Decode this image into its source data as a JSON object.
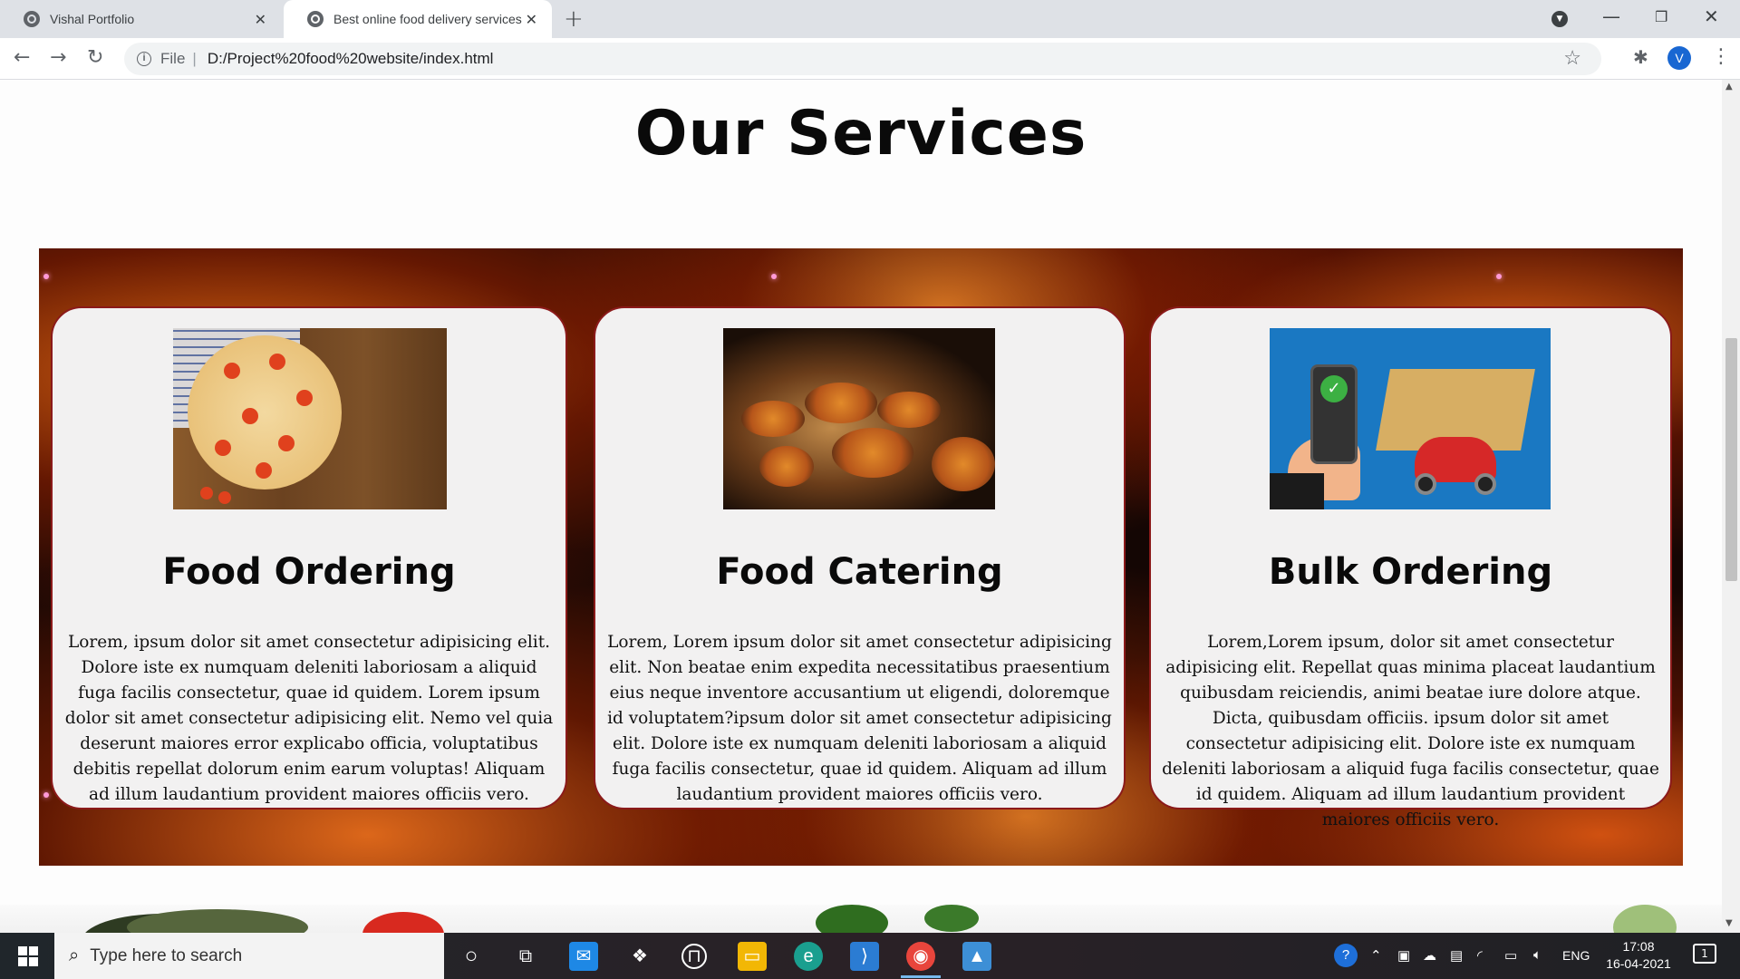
{
  "browser": {
    "tabs": [
      {
        "title": "Vishal Portfolio",
        "active": false
      },
      {
        "title": "Best online food delivery services",
        "active": true
      }
    ],
    "url_scheme_label": "File",
    "url": "D:/Project%20food%20website/index.html",
    "profile_initial": "V"
  },
  "page": {
    "title": "Our Services",
    "services": [
      {
        "name": "Food Ordering",
        "description": "Lorem, ipsum dolor sit amet consectetur adipisicing elit. Dolore iste ex numquam deleniti laboriosam a aliquid fuga facilis consectetur, quae id quidem. Lorem ipsum dolor sit amet consectetur adipisicing elit. Nemo vel quia deserunt maiores error explicabo officia, voluptatibus debitis repellat dolorum enim earum voluptas! Aliquam ad illum laudantium provident maiores officiis vero."
      },
      {
        "name": "Food Catering",
        "description": "Lorem, Lorem ipsum dolor sit amet consectetur adipisicing elit. Non beatae enim expedita necessitatibus praesentium eius neque inventore accusantium ut eligendi, doloremque id voluptatem?ipsum dolor sit amet consectetur adipisicing elit. Dolore iste ex numquam deleniti laboriosam a aliquid fuga facilis consectetur, quae id quidem. Aliquam ad illum laudantium provident maiores officiis vero."
      },
      {
        "name": "Bulk Ordering",
        "description": "Lorem,Lorem ipsum, dolor sit amet consectetur adipisicing elit. Repellat quas minima placeat laudantium quibusdam reiciendis, animi beatae iure dolore atque. Dicta, quibusdam officiis. ipsum dolor sit amet consectetur adipisicing elit. Dolore iste ex numquam deleniti laboriosam a aliquid fuga facilis consectetur, quae id quidem. Aliquam ad illum laudantium provident maiores officiis vero."
      }
    ]
  },
  "taskbar": {
    "search_placeholder": "Type here to search",
    "language": "ENG",
    "time": "17:08",
    "date": "16-04-2021",
    "notification_count": "1"
  },
  "colors": {
    "card_border": "#8b1a1a",
    "card_background": "#f2f1f1",
    "address_bar": "#f1f3f4",
    "taskbar": "#20262b"
  },
  "icons": {
    "tabs": "globe-icon",
    "close": "close-icon",
    "new_tab": "plus-icon",
    "nav_back": "back-arrow-icon",
    "nav_forward": "forward-arrow-icon",
    "reload": "reload-icon",
    "info": "info-icon",
    "bookmark": "star-icon",
    "extensions": "puzzle-icon",
    "menu": "kebab-menu-icon"
  }
}
